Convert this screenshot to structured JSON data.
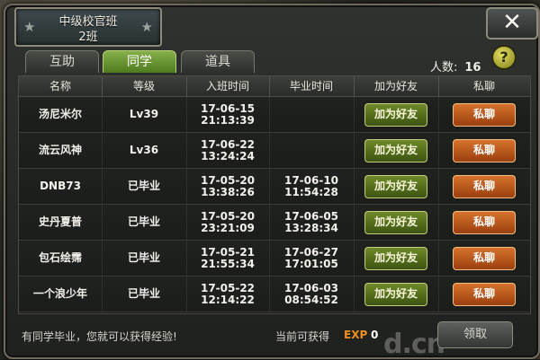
{
  "dialog": {
    "title_line1": "中级校官班",
    "title_line2": "2班",
    "close_glyph": "✕"
  },
  "tabs": [
    {
      "label": "互助",
      "active": false
    },
    {
      "label": "同学",
      "active": true
    },
    {
      "label": "道具",
      "active": false
    }
  ],
  "people": {
    "label": "人数:",
    "count": "16"
  },
  "help_glyph": "?",
  "table": {
    "headers": [
      "名称",
      "等级",
      "入班时间",
      "毕业时间",
      "加为好友",
      "私聊"
    ],
    "rows": [
      {
        "name": "汤尼米尔",
        "level": "Lv39",
        "join_date": "17-06-15",
        "join_time": "21:13:39",
        "grad_date": "",
        "grad_time": "",
        "friend_label": "加为好友",
        "chat_label": "私聊"
      },
      {
        "name": "流云风神",
        "level": "Lv36",
        "join_date": "17-06-22",
        "join_time": "13:24:24",
        "grad_date": "",
        "grad_time": "",
        "friend_label": "加为好友",
        "chat_label": "私聊"
      },
      {
        "name": "DNB73",
        "level": "已毕业",
        "join_date": "17-05-20",
        "join_time": "13:38:26",
        "grad_date": "17-06-10",
        "grad_time": "11:54:28",
        "friend_label": "加为好友",
        "chat_label": "私聊"
      },
      {
        "name": "史丹夏普",
        "level": "已毕业",
        "join_date": "17-05-20",
        "join_time": "23:21:09",
        "grad_date": "17-06-05",
        "grad_time": "13:28:34",
        "friend_label": "加为好友",
        "chat_label": "私聊"
      },
      {
        "name": "包石绘霈",
        "level": "已毕业",
        "join_date": "17-05-21",
        "join_time": "21:55:34",
        "grad_date": "17-06-27",
        "grad_time": "17:01:05",
        "friend_label": "加为好友",
        "chat_label": "私聊"
      },
      {
        "name": "一个浪少年",
        "level": "已毕业",
        "join_date": "17-05-22",
        "join_time": "12:14:22",
        "grad_date": "17-06-03",
        "grad_time": "08:54:52",
        "friend_label": "加为好友",
        "chat_label": "私聊"
      }
    ]
  },
  "footer": {
    "note": "有同学毕业，您就可以获得经验!",
    "available_label": "当前可获得",
    "exp_label": "EXP",
    "exp_value": "0",
    "claim_label": "领取",
    "watermark": "d.cn"
  },
  "colors": {
    "tab_active": "#6f9a34",
    "friend_button": "#55701e",
    "chat_button": "#c45a1e",
    "exp_accent": "#ef8f1e"
  }
}
